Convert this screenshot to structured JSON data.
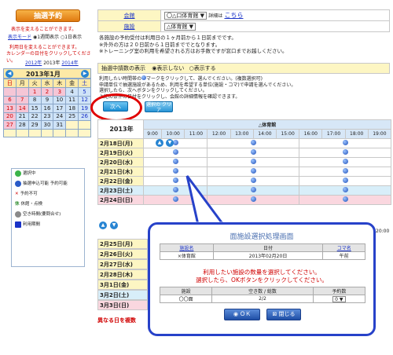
{
  "left": {
    "title": "抽選予約",
    "note1": "表示を変えることができます。",
    "mode_label": "表示モード",
    "mode_options": [
      "1週間表示",
      "1日表示"
    ],
    "note2": "利用日を変えることができます。",
    "note3": "カレンダーの日付をクリックしてください。",
    "year_links": [
      "2012年",
      "2013年",
      "2014年"
    ],
    "cal_title": "2013年1月",
    "cal_headers": [
      "日",
      "月",
      "火",
      "水",
      "木",
      "金",
      "土"
    ],
    "cal_rows": [
      [
        "",
        "",
        "1",
        "2",
        "3",
        "4",
        "5"
      ],
      [
        "6",
        "7",
        "8",
        "9",
        "10",
        "11",
        "12"
      ],
      [
        "13",
        "14",
        "15",
        "16",
        "17",
        "18",
        "19"
      ],
      [
        "20",
        "21",
        "22",
        "23",
        "24",
        "25",
        "26"
      ],
      [
        "27",
        "28",
        "29",
        "30",
        "31",
        "",
        ""
      ],
      [
        "",
        "",
        "",
        "",
        "",
        "",
        ""
      ]
    ],
    "legend": [
      "選択中",
      "抽選申込可能 予約可能",
      "予約不可",
      "休館・点検",
      "空き時間(要問合せ)",
      "利用期間"
    ]
  },
  "form": {
    "row1_label": "会館",
    "row1_value": "〇△口体育館",
    "row1_detail": "詳細は",
    "row1_link": "こちら",
    "row2_label": "施設",
    "row2_value": "△体育館"
  },
  "notes": [
    "各施設の予約受付は利用日の１ヶ月前から１日前までです。",
    "※外外の方は２０日前から１日前まででとなります。",
    "※トレーニング室の利用を希望される方はお手数ですが窓口までお越しください。"
  ],
  "display_row": {
    "label": "抽選中請数の表示",
    "opt1": "表示しない",
    "opt2": "表示する"
  },
  "instructions": [
    "利用したい時間帯の",
    "マークをクリックして、選んでください。(複数選択可)",
    "申請単位で抽選施設があるため、利用を希望する単位(施設・コマ)で申請を選んでください。",
    "選択したら、次へボタンをクリックしてください。",
    "上記の条件の日付をクリックし、会館の詳細情報を確認できます。"
  ],
  "buttons": {
    "next": "次へ",
    "clear": "選択の クリア"
  },
  "grid": {
    "year": "2013年",
    "facility": "△体育館",
    "times": [
      "9:00",
      "10:00",
      "11:00",
      "12:00",
      "13:00",
      "14:00",
      "15:00",
      "16:00",
      "17:00",
      "18:00",
      "19:00"
    ],
    "dates_top": [
      "2月18日(月)",
      "2月19日(火)",
      "2月20日(水)",
      "2月21日(木)",
      "2月22日(金)",
      "2月23日(土)",
      "2月24日(日)"
    ],
    "dates_bottom": [
      "2月25日(月)",
      "2月26日(火)",
      "2月27日(水)",
      "2月28日(木)",
      "3月1日(金)",
      "3月2日(土)",
      "3月3日(日)"
    ],
    "time_bottom": "20:00"
  },
  "footer_note": "異なる日を複数",
  "popup": {
    "title": "面施設選択処理画面",
    "col_headers": [
      "施設名",
      "日付",
      "コマ名"
    ],
    "row_values": [
      "×体育館",
      "2013年02月20日",
      "午前"
    ],
    "message1": "利用したい施設の数量を選択してください。",
    "message2": "選択したら、OKボタンをクリックしてください。",
    "qty_headers": [
      "施設",
      "空き数 / 総数",
      "予約数"
    ],
    "qty_values": [
      "〇〇面",
      "2/2",
      "0"
    ],
    "ok": "ＯＫ",
    "close": "閉じる"
  }
}
